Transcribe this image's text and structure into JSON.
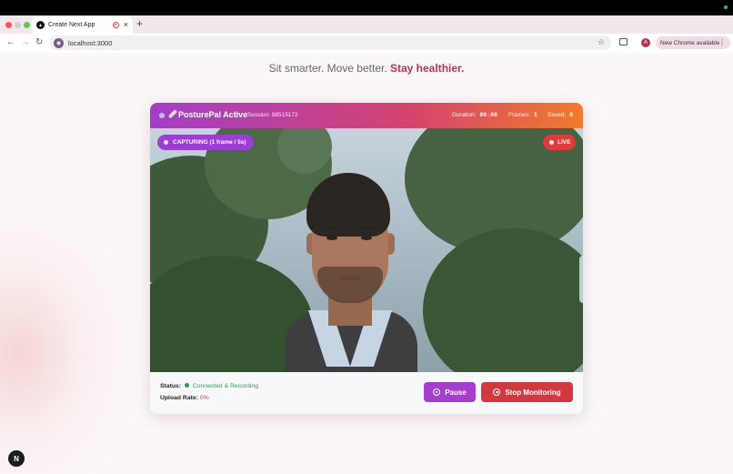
{
  "browser": {
    "tab_title": "Create Next App",
    "tab_close": "×",
    "new_tab": "+",
    "url": "localhost:3000",
    "profile_initial": "A",
    "update_label": "New Chrome available",
    "site_icon_glyph": "◉",
    "favicon_glyph": "▲"
  },
  "page": {
    "tagline_plain": "Sit smarter. Move better. ",
    "tagline_strong": "Stay healthier."
  },
  "monitor": {
    "header": {
      "icon": "🩹",
      "title": "PosturePal Active",
      "session_label": "Session: 98515172",
      "duration_label": "Duration:",
      "duration_value": "00:06",
      "frames_label": "Frames:",
      "frames_value": "1",
      "saved_label": "Saved:",
      "saved_value": "0"
    },
    "capture_badge": "CAPTURING (1 frame / 5s)",
    "live_badge": "LIVE",
    "status_label": "Status:",
    "status_value": "Connected & Recording",
    "upload_label": "Upload Rate:",
    "upload_value": "0%",
    "pause_label": "Pause",
    "stop_label": "Stop Monitoring"
  },
  "next_badge": "N",
  "colors": {
    "header_gradient": [
      "#a23fc8",
      "#d4446e",
      "#ef7b2d"
    ],
    "capturing": "#9a3fd1",
    "live": "#e03b3b",
    "pause": "#a33fcb",
    "stop": "#d0393f",
    "status_ok": "#2f9d4d",
    "accent_text": "#b8335a"
  }
}
